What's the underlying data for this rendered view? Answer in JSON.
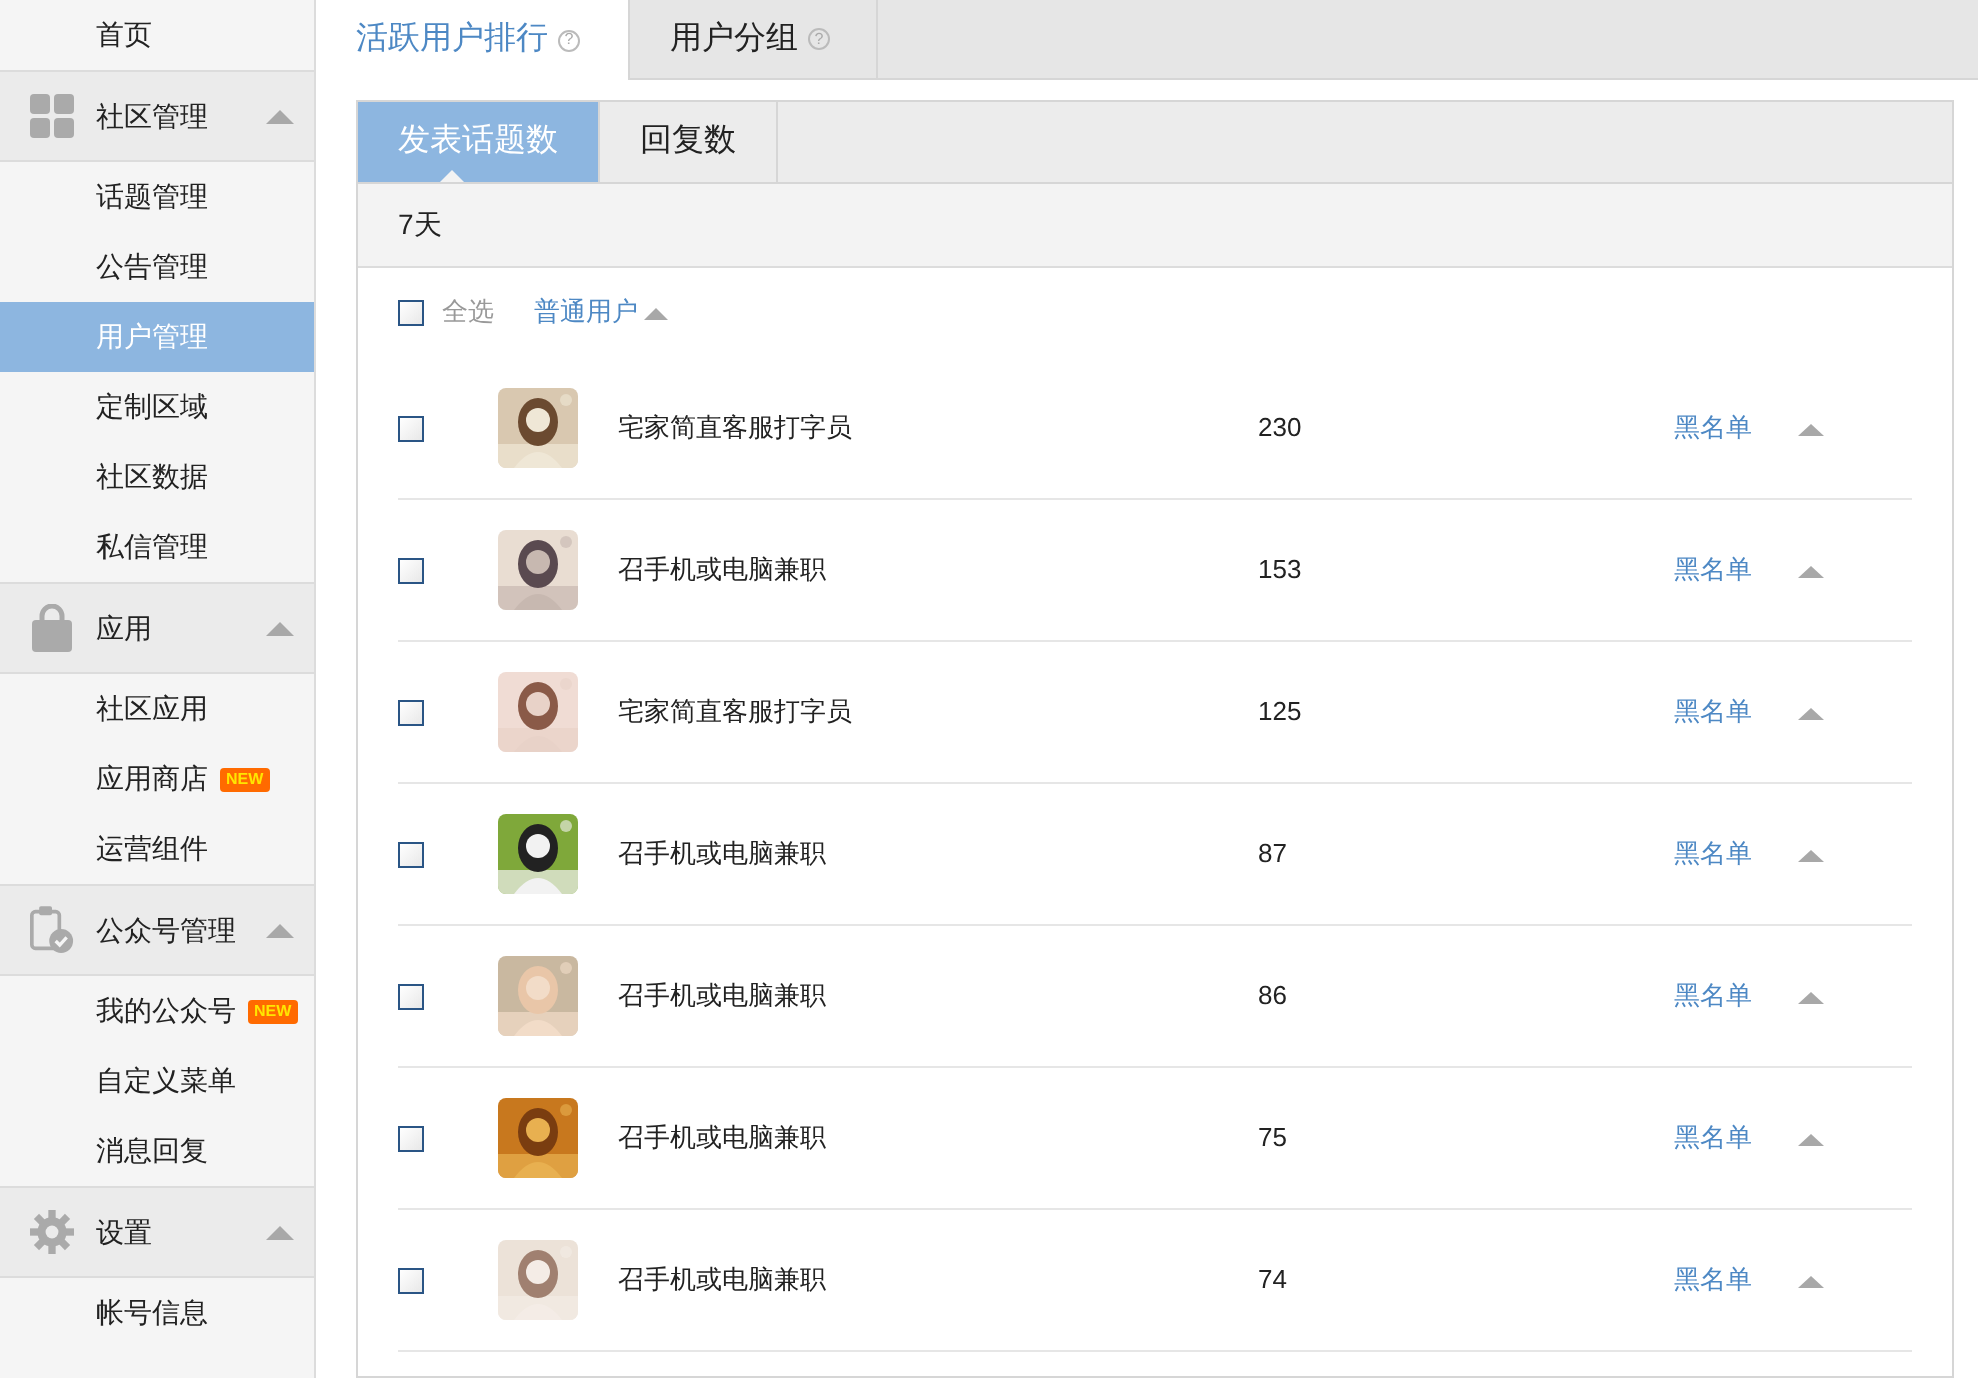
{
  "sidebar": {
    "items": [
      {
        "kind": "link",
        "label": "首页",
        "selected": false
      },
      {
        "kind": "group",
        "label": "社区管理",
        "expanded": true
      },
      {
        "kind": "link",
        "label": "话题管理",
        "selected": false
      },
      {
        "kind": "link",
        "label": "公告管理",
        "selected": false
      },
      {
        "kind": "link",
        "label": "用户管理",
        "selected": true
      },
      {
        "kind": "link",
        "label": "定制区域",
        "selected": false
      },
      {
        "kind": "link",
        "label": "社区数据",
        "selected": false
      },
      {
        "kind": "link",
        "label": "私信管理",
        "selected": false
      },
      {
        "kind": "group",
        "label": "应用",
        "expanded": true
      },
      {
        "kind": "link",
        "label": "社区应用",
        "selected": false
      },
      {
        "kind": "link",
        "label": "应用商店",
        "selected": false,
        "badge": "NEW"
      },
      {
        "kind": "link",
        "label": "运营组件",
        "selected": false
      },
      {
        "kind": "group",
        "label": "公众号管理",
        "expanded": true
      },
      {
        "kind": "link",
        "label": "我的公众号",
        "selected": false,
        "badge": "NEW"
      },
      {
        "kind": "link",
        "label": "自定义菜单",
        "selected": false
      },
      {
        "kind": "link",
        "label": "消息回复",
        "selected": false
      },
      {
        "kind": "group",
        "label": "设置",
        "expanded": true
      },
      {
        "kind": "link",
        "label": "帐号信息",
        "selected": false
      }
    ]
  },
  "tabs": [
    {
      "label": "活跃用户排行",
      "help": "?",
      "selected": true
    },
    {
      "label": "用户分组",
      "help": "?",
      "selected": false
    }
  ],
  "sub_tabs": [
    {
      "label": "发表话题数",
      "selected": true
    },
    {
      "label": "回复数",
      "selected": false
    }
  ],
  "period": "7天",
  "filter": {
    "select_all": "全选",
    "checked": false,
    "user_type": "普通用户"
  },
  "rows": [
    {
      "checked": false,
      "name": "宅家简直客服打字员",
      "count": "230",
      "action": "黑名单"
    },
    {
      "checked": false,
      "name": "召手机或电脑兼职",
      "count": "153",
      "action": "黑名单"
    },
    {
      "checked": false,
      "name": "宅家简直客服打字员",
      "count": "125",
      "action": "黑名单"
    },
    {
      "checked": false,
      "name": "召手机或电脑兼职",
      "count": "87",
      "action": "黑名单"
    },
    {
      "checked": false,
      "name": "召手机或电脑兼职",
      "count": "86",
      "action": "黑名单"
    },
    {
      "checked": false,
      "name": "召手机或电脑兼职",
      "count": "75",
      "action": "黑名单"
    },
    {
      "checked": false,
      "name": "召手机或电脑兼职",
      "count": "74",
      "action": "黑名单"
    }
  ]
}
